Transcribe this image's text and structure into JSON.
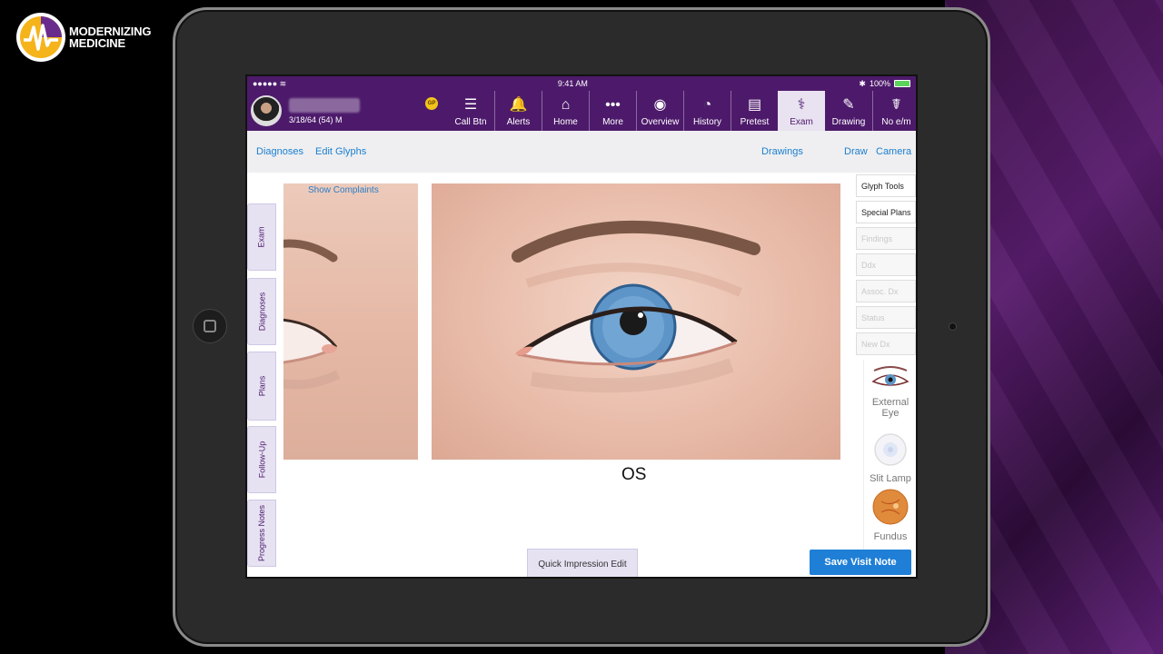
{
  "brand": {
    "line1": "MODERNIZING",
    "line2": "MEDICINE"
  },
  "status_bar": {
    "time": "9:41 AM",
    "battery": "100%"
  },
  "patient": {
    "dob_age_sex": "3/18/64 (54) M",
    "badge": "GP"
  },
  "nav": {
    "items": [
      {
        "label": "Call Btn",
        "icon": "list-icon"
      },
      {
        "label": "Alerts",
        "icon": "bell-icon"
      },
      {
        "label": "Home",
        "icon": "home-icon"
      },
      {
        "label": "More",
        "icon": "dots-icon"
      },
      {
        "label": "Overview",
        "icon": "person-icon"
      },
      {
        "label": "History",
        "icon": "clock-icon"
      },
      {
        "label": "Pretest",
        "icon": "clipboard-icon"
      },
      {
        "label": "Exam",
        "icon": "stethoscope-icon"
      },
      {
        "label": "Drawing",
        "icon": "eraser-icon"
      },
      {
        "label": "No e/m",
        "icon": "caduceus-icon"
      }
    ],
    "active": "Exam"
  },
  "subbar": {
    "diagnoses": "Diagnoses",
    "edit_glyphs": "Edit Glyphs",
    "drawings": "Drawings",
    "draw": "Draw",
    "camera": "Camera"
  },
  "left_tabs": [
    "Exam",
    "Diagnoses",
    "Plans",
    "Follow-Up",
    "Progress Notes"
  ],
  "canvas": {
    "show_complaints": "Show Complaints",
    "eye_label": "OS"
  },
  "right_tools": {
    "buttons": [
      {
        "label": "Glyph Tools",
        "enabled": true
      },
      {
        "label": "Special Plans",
        "enabled": true
      },
      {
        "label": "Findings",
        "enabled": false
      },
      {
        "label": "Ddx",
        "enabled": false
      },
      {
        "label": "Assoc. Dx",
        "enabled": false
      },
      {
        "label": "Status",
        "enabled": false
      },
      {
        "label": "New Dx",
        "enabled": false
      }
    ]
  },
  "glyphs": {
    "external_eye": "External Eye",
    "slit_lamp": "Slit Lamp",
    "fundus": "Fundus"
  },
  "footer": {
    "quick_impression": "Quick Impression Edit",
    "save": "Save Visit Note"
  },
  "colors": {
    "nav_purple": "#4d1a6b",
    "link_blue": "#1a7fd0",
    "save_blue": "#1f7fd6",
    "tab_lavender": "#e6e2f2"
  }
}
